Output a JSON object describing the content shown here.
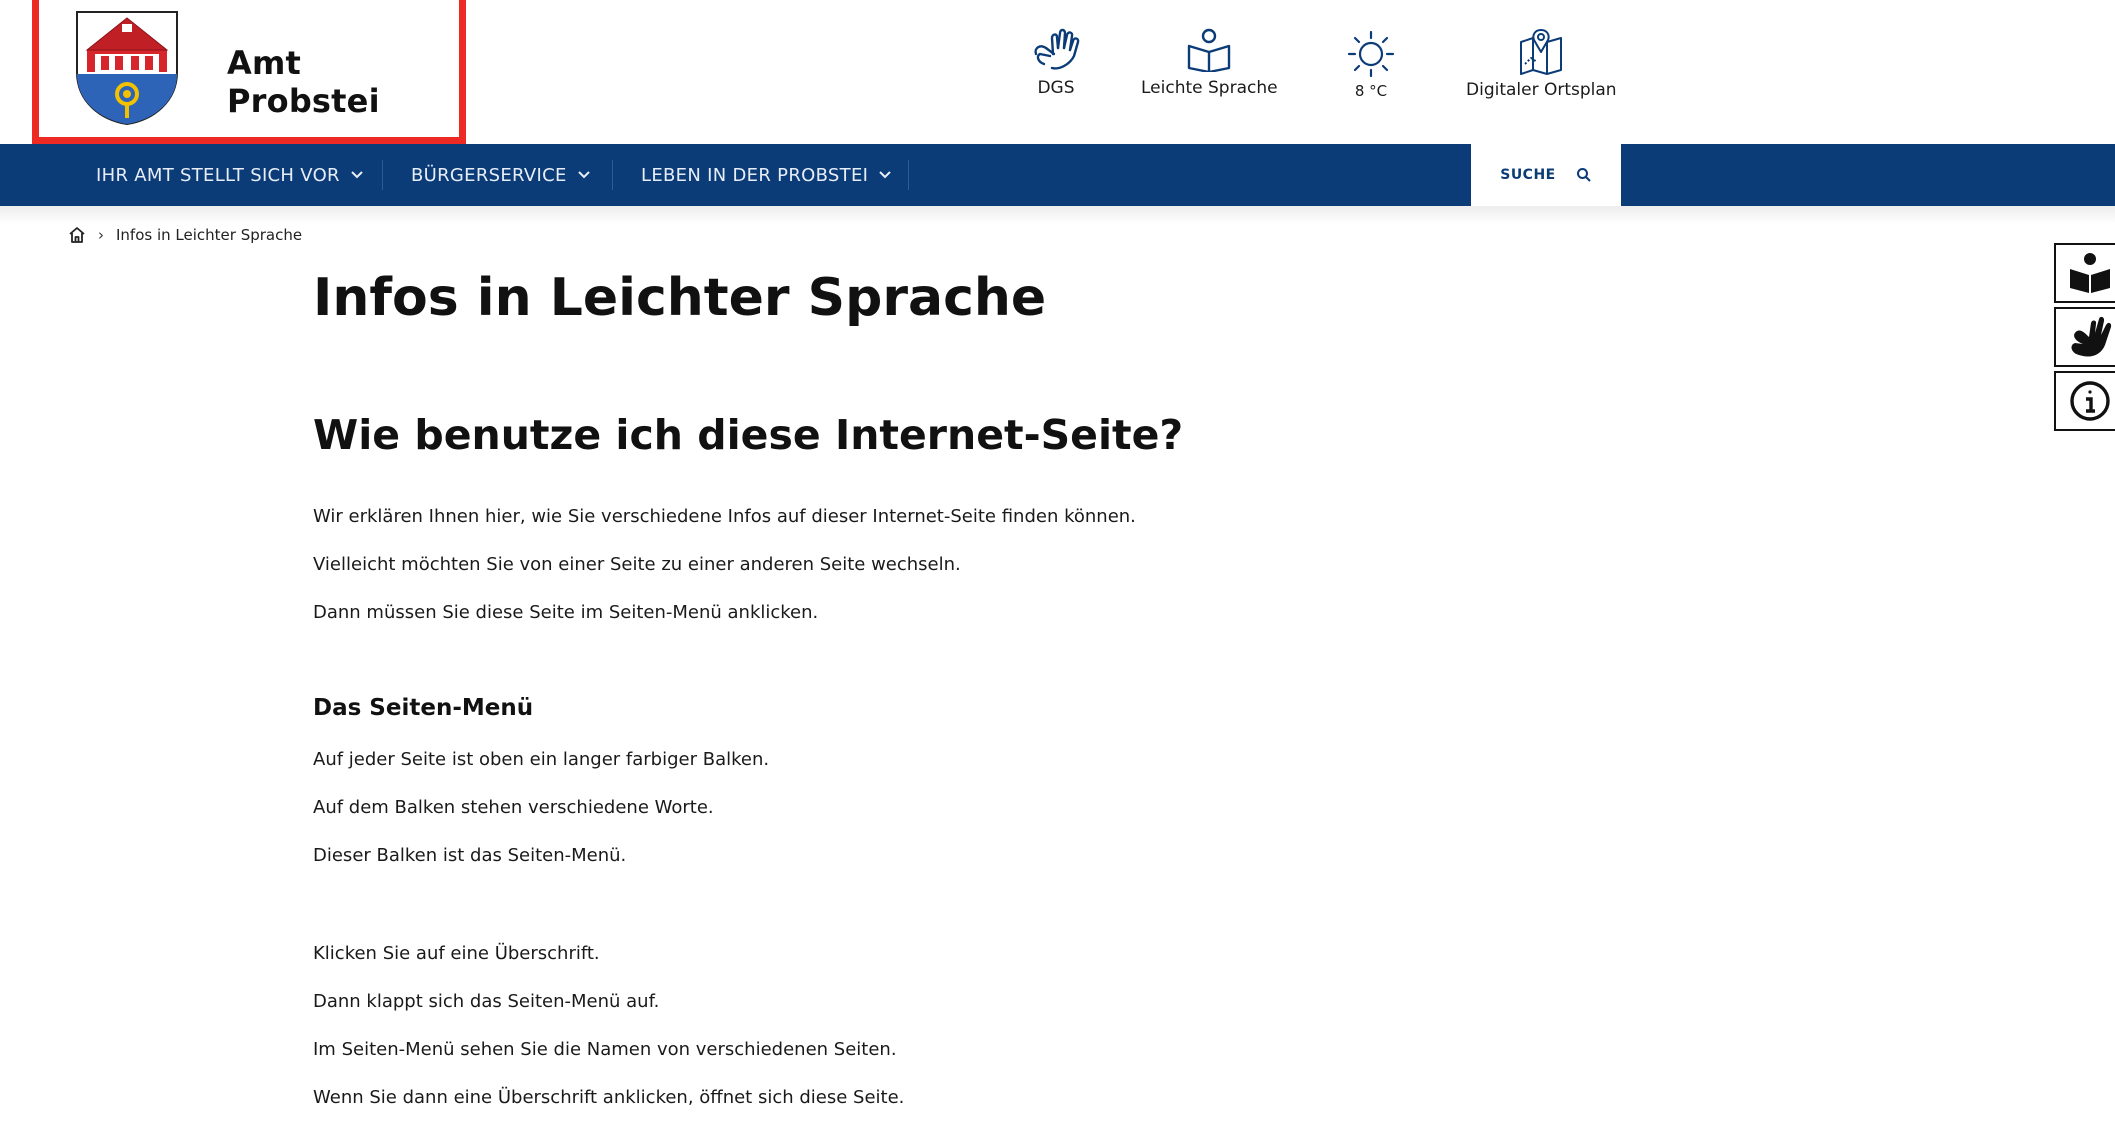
{
  "header": {
    "site_title": "Amt Probstei",
    "utilities": [
      {
        "label": "DGS",
        "icon": "sign-language-icon"
      },
      {
        "label": "Leichte Sprache",
        "icon": "book-reader-icon"
      },
      {
        "label": "8 °C",
        "icon": "sun-icon"
      },
      {
        "label": "Digitaler Ortsplan",
        "icon": "map-pin-icon"
      }
    ]
  },
  "nav": {
    "items": [
      {
        "label": "IHR AMT STELLT SICH VOR"
      },
      {
        "label": "BÜRGERSERVICE"
      },
      {
        "label": "LEBEN IN DER PROBSTEI"
      }
    ],
    "search_label": "SUCHE"
  },
  "breadcrumb": {
    "current": "Infos in Leichter Sprache"
  },
  "content": {
    "title": "Infos in Leichter Sprache",
    "section_title": "Wie benutze ich diese Internet-Seite?",
    "intro": [
      "Wir erklären Ihnen hier, wie Sie verschiedene Infos auf dieser Internet-Seite finden können.",
      "Vielleicht möchten Sie von einer Seite zu einer anderen Seite wechseln.",
      "Dann müssen Sie diese Seite im Seiten-Menü anklicken."
    ],
    "sub_title": "Das Seiten-Menü",
    "menu_paragraphs": [
      "Auf jeder Seite ist oben ein langer farbiger Balken.",
      "Auf dem Balken stehen verschiedene Worte.",
      "Dieser Balken ist das Seiten-Menü."
    ],
    "click_paragraphs": [
      "Klicken Sie auf eine Überschrift.",
      "Dann klappt sich das Seiten-Menü auf.",
      "Im Seiten-Menü sehen Sie die Namen von verschiedenen Seiten.",
      "Wenn Sie dann eine Überschrift anklicken, öffnet sich diese Seite."
    ]
  },
  "side_tools": [
    {
      "icon": "easy-language-icon"
    },
    {
      "icon": "sign-language-icon"
    },
    {
      "icon": "info-icon"
    }
  ],
  "colors": {
    "nav_bg": "#0b3c78",
    "highlight": "#ee2a24"
  }
}
